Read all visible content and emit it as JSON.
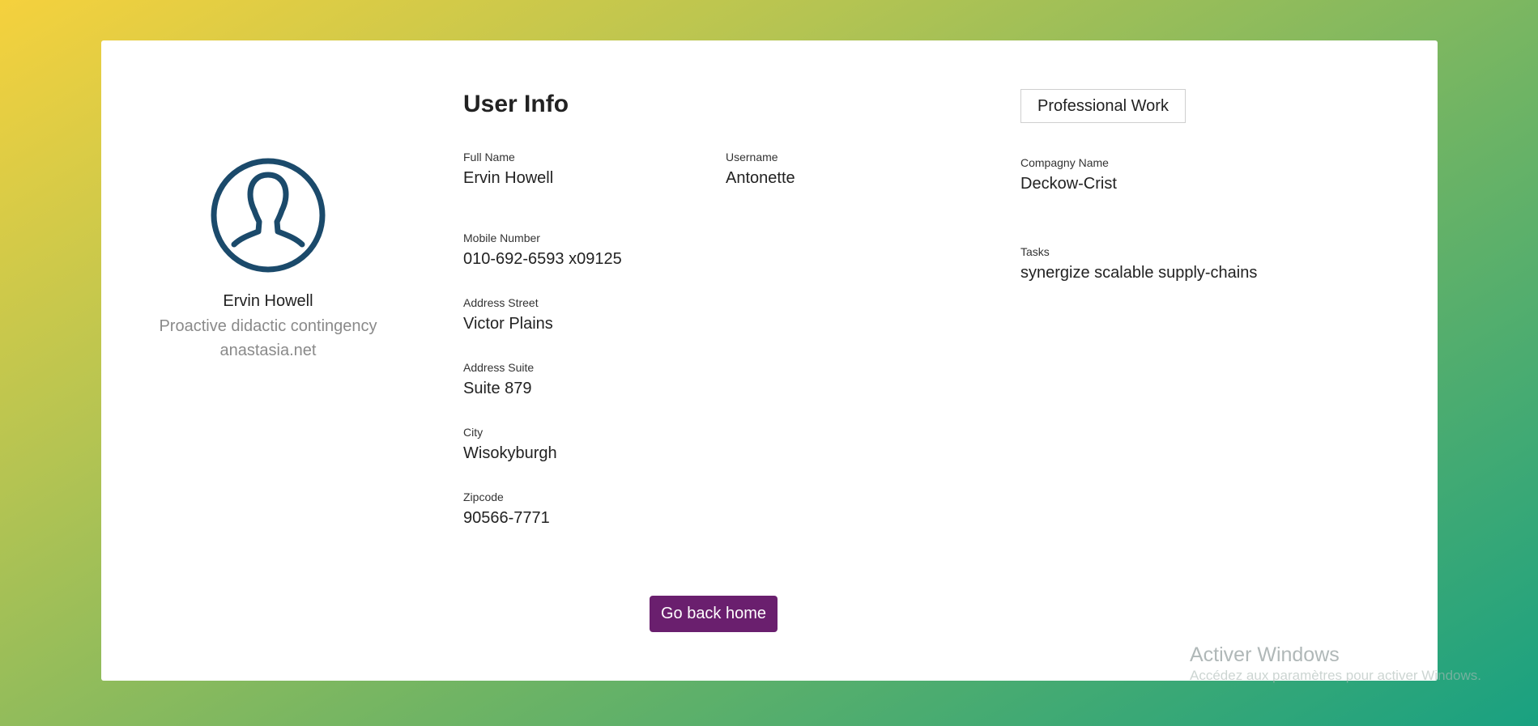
{
  "profile": {
    "name": "Ervin Howell",
    "catch_phrase": "Proactive didactic contingency",
    "website": "anastasia.net",
    "avatar_icon": "user-circle-icon"
  },
  "user_info": {
    "title": "User Info",
    "full_name": {
      "label": "Full Name",
      "value": "Ervin Howell"
    },
    "username": {
      "label": "Username",
      "value": "Antonette"
    },
    "mobile": {
      "label": "Mobile Number",
      "value": "010-692-6593 x09125"
    },
    "street": {
      "label": "Address Street",
      "value": "Victor Plains"
    },
    "suite": {
      "label": "Address Suite",
      "value": "Suite 879"
    },
    "city": {
      "label": "City",
      "value": "Wisokyburgh"
    },
    "zipcode": {
      "label": "Zipcode",
      "value": "90566-7771"
    }
  },
  "professional": {
    "badge": "Professional Work",
    "company": {
      "label": "Compagny Name",
      "value": "Deckow-Crist"
    },
    "tasks": {
      "label": "Tasks",
      "value": "synergize scalable supply-chains"
    }
  },
  "actions": {
    "back_home_label": "Go back home"
  },
  "watermark": {
    "title": "Activer Windows",
    "subtitle": "Accédez aux paramètres pour activer Windows."
  },
  "colors": {
    "accent": "#6a1f6e",
    "avatar": "#1b4a6b",
    "gradient_start": "#f5d13d",
    "gradient_end": "#19a181"
  }
}
